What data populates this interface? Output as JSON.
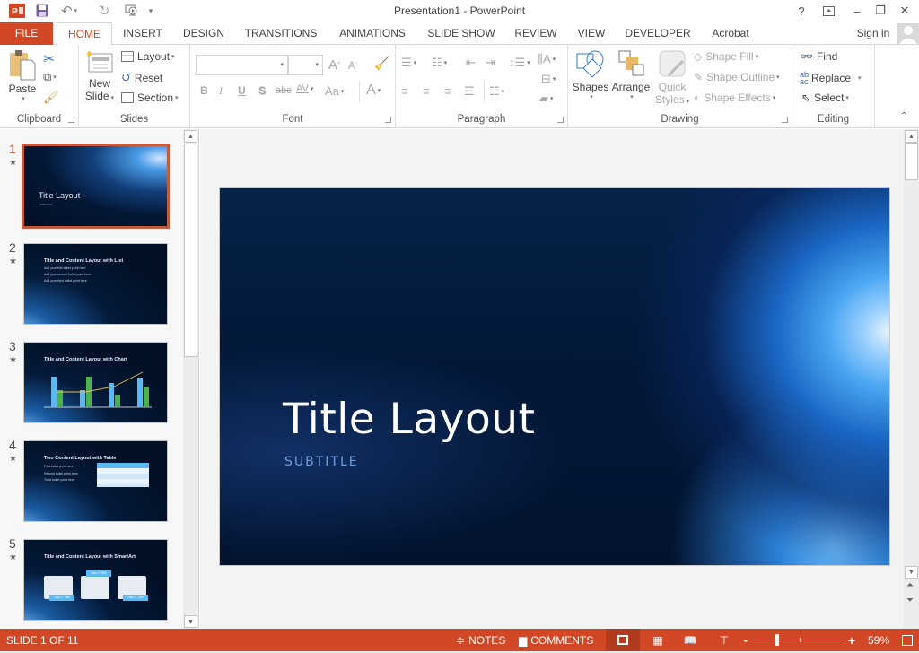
{
  "titlebar": {
    "app_title": "Presentation1 - PowerPoint",
    "quick_access": [
      "powerpoint-logo",
      "save",
      "undo",
      "redo",
      "start-from-beginning",
      "customize"
    ],
    "window_controls": {
      "help": "?",
      "ribbon_display": "⊼",
      "minimize": "–",
      "restore": "❐",
      "close": "✕"
    }
  },
  "tabs": {
    "file": "FILE",
    "items": [
      "HOME",
      "INSERT",
      "DESIGN",
      "TRANSITIONS",
      "ANIMATIONS",
      "SLIDE SHOW",
      "REVIEW",
      "VIEW",
      "DEVELOPER",
      "Acrobat"
    ],
    "active": "HOME",
    "sign_in": "Sign in"
  },
  "ribbon": {
    "clipboard": {
      "label": "Clipboard",
      "paste": "Paste"
    },
    "slides": {
      "label": "Slides",
      "new_slide_1": "New",
      "new_slide_2": "Slide",
      "layout": "Layout",
      "reset": "Reset",
      "section": "Section"
    },
    "font": {
      "label": "Font",
      "font_name": "",
      "font_size": "",
      "bold": "B",
      "italic": "I",
      "underline": "U",
      "shadow": "S",
      "strikethrough": "abc",
      "spacing": "AV",
      "change_case": "Aa",
      "font_color": "A",
      "grow": "A",
      "shrink": "A"
    },
    "paragraph": {
      "label": "Paragraph"
    },
    "drawing": {
      "label": "Drawing",
      "shapes": "Shapes",
      "arrange": "Arrange",
      "quick_styles_1": "Quick",
      "quick_styles_2": "Styles",
      "shape_fill": "Shape Fill",
      "shape_outline": "Shape Outline",
      "shape_effects": "Shape Effects"
    },
    "editing": {
      "label": "Editing",
      "find": "Find",
      "replace": "Replace",
      "select": "Select"
    }
  },
  "thumbnails": [
    {
      "num": "1",
      "title": "Title Layout",
      "subtitle": "SUBTITLE",
      "selected": true
    },
    {
      "num": "2",
      "title": "Title and Content Layout with List",
      "bullets": [
        "Add your first bullet point here",
        "Add your second bullet point here",
        "Add your third bullet point here"
      ]
    },
    {
      "num": "3",
      "title": "Title and Content Layout with Chart"
    },
    {
      "num": "4",
      "title": "Two Content Layout with Table",
      "bullets": [
        "First bullet point here",
        "Second bullet point here",
        "Third bullet point here"
      ]
    },
    {
      "num": "5",
      "title": "Title and Content Layout with SmartArt",
      "steps": [
        "Step 1 Title",
        "Step 2 Title",
        "Step 3 Title"
      ]
    }
  ],
  "slide": {
    "title": "Title Layout",
    "subtitle": "SUBTITLE"
  },
  "status": {
    "slide_indicator": "SLIDE 1 OF 11",
    "notes": "NOTES",
    "comments": "COMMENTS",
    "zoom_percent": "59%",
    "zoom_level": 59
  },
  "colors": {
    "accent": "#d24726",
    "selected_thumb": "#c55a3c",
    "subtitle": "#6e9ee0"
  }
}
